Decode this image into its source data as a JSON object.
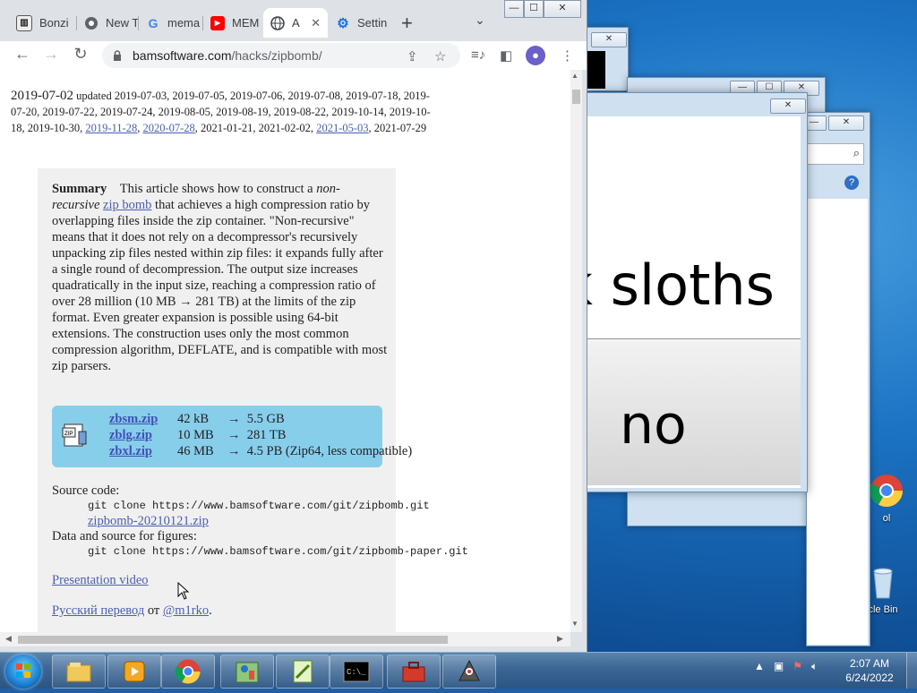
{
  "browser": {
    "tabs": [
      {
        "label": "Bonzi",
        "icon": "bank-icon",
        "active": false
      },
      {
        "label": "New T",
        "icon": "chrome-icon",
        "active": false
      },
      {
        "label": "mema",
        "icon": "google-icon",
        "active": false
      },
      {
        "label": "MEM",
        "icon": "youtube-icon",
        "active": false
      },
      {
        "label": "A",
        "icon": "globe-icon",
        "active": true
      },
      {
        "label": "Settin",
        "icon": "gear-icon",
        "active": false
      }
    ],
    "new_tab": "+",
    "tab_search": "⌄",
    "url_host": "bamsoftware.com",
    "url_path": "/hacks/zipbomb/",
    "window_controls": {
      "minimize": "—",
      "maximize": "☐",
      "close": "✕"
    }
  },
  "article": {
    "date_main": "2019-07-02",
    "updated_prefix": "updated 2019-07-03, 2019-07-05, 2019-07-06, 2019-07-08, 2019-07-18, 2019-07-20, 2019-07-22, 2019-07-24, 2019-08-05, 2019-08-19, 2019-08-22, 2019-10-14, 2019-10-18, 2019-10-30, ",
    "updated_link1": "2019-11-28",
    "updated_sep1": ", ",
    "updated_link2": "2020-07-28",
    "updated_mid": ", 2021-01-21, 2021-02-02, ",
    "updated_link3": "2021-05-03",
    "updated_end": ", 2021-07-29",
    "summary_label": "Summary",
    "summary_p1": "This article shows how to construct a ",
    "summary_em1": "non-recursive",
    "summary_p2": " ",
    "summary_link": "zip bomb",
    "summary_p3": " that achieves a high compression ratio by overlapping files inside the zip container. \"Non-recursive\" means that it does not rely on a decompressor's recursively unpacking zip files nested within zip files: it expands fully after a single round of decompression. The output size increases quadratically in the input size, reaching a compression ratio of over 28 million (10 MB → 281 TB) at the limits of the zip format. Even greater expansion is possible using 64-bit extensions. The construction uses only the most common compression algorithm, DEFLATE, and is compatible with most zip parsers.",
    "downloads": [
      {
        "name": "zbsm.zip",
        "size": "42 kB",
        "arrow": "→",
        "result": "5.5 GB"
      },
      {
        "name": "zblg.zip",
        "size": "10 MB",
        "arrow": "→",
        "result": "281 TB"
      },
      {
        "name": "zbxl.zip",
        "size": "46 MB",
        "arrow": "→",
        "result": "4.5 PB (Zip64, less compatible)"
      }
    ],
    "source_label": "Source code:",
    "source_cmd": "git clone https://www.bamsoftware.com/git/zipbomb.git",
    "source_link": "zipbomb-20210121.zip",
    "figures_label": "Data and source for figures:",
    "figures_cmd": "git clone https://www.bamsoftware.com/git/zipbomb-paper.git",
    "video_link": "Presentation video",
    "ru_link": "Русский перевод",
    "ru_from": " от ",
    "ru_author": "@m1rko",
    "ru_end": "."
  },
  "background_window": {
    "text": "k sloths",
    "button_label": "no"
  },
  "desktop_icons": [
    {
      "label": "ol",
      "icon": "chrome-icon"
    },
    {
      "label": "cle Bin",
      "icon": "recycle-bin-icon"
    }
  ],
  "taskbar": {
    "apps": [
      "explorer-icon",
      "media-player-icon",
      "chrome-icon",
      "paint-icon",
      "notepad-plus-icon",
      "cmd-icon",
      "toolbox-icon",
      "java-icon"
    ],
    "time": "2:07 AM",
    "date": "6/24/2022"
  }
}
